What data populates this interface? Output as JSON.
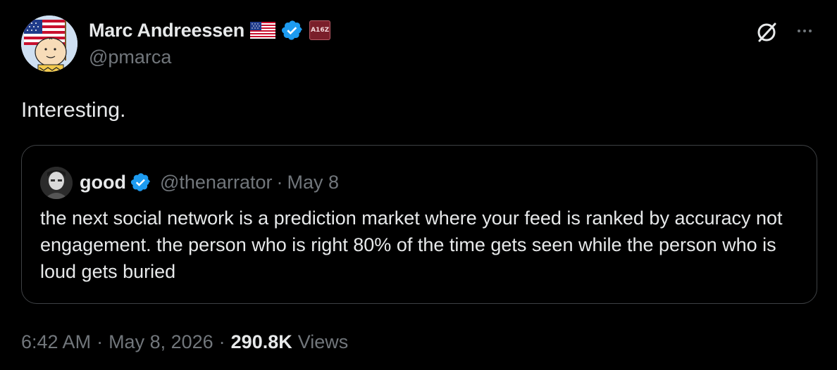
{
  "author": {
    "display_name": "Marc Andreessen",
    "handle": "@pmarca",
    "verified": true,
    "badges": [
      "us-flag-icon",
      "verified-badge-icon",
      "a16z-affiliate-badge"
    ],
    "affiliate_badge_text": "A16Z"
  },
  "tweet": {
    "text": "Interesting."
  },
  "quoted": {
    "display_name": "good",
    "handle": "@thenarrator",
    "separator": "·",
    "date": "May 8",
    "text": "the next social network is a prediction market where your feed is ranked by accuracy not engagement. the person who is right 80% of the time gets seen while the person who is loud gets buried"
  },
  "meta": {
    "time": "6:42 AM",
    "sep1": "·",
    "date": "May 8, 2026",
    "sep2": "·",
    "views_count": "290.8K",
    "views_label": "Views"
  },
  "icons": {
    "grok": "grok-icon",
    "more": "more-options-icon"
  },
  "colors": {
    "background": "#000000",
    "text_primary": "#e7e9ea",
    "text_secondary": "#71767b",
    "border": "#3e4144",
    "verified": "#1d9bf0"
  }
}
